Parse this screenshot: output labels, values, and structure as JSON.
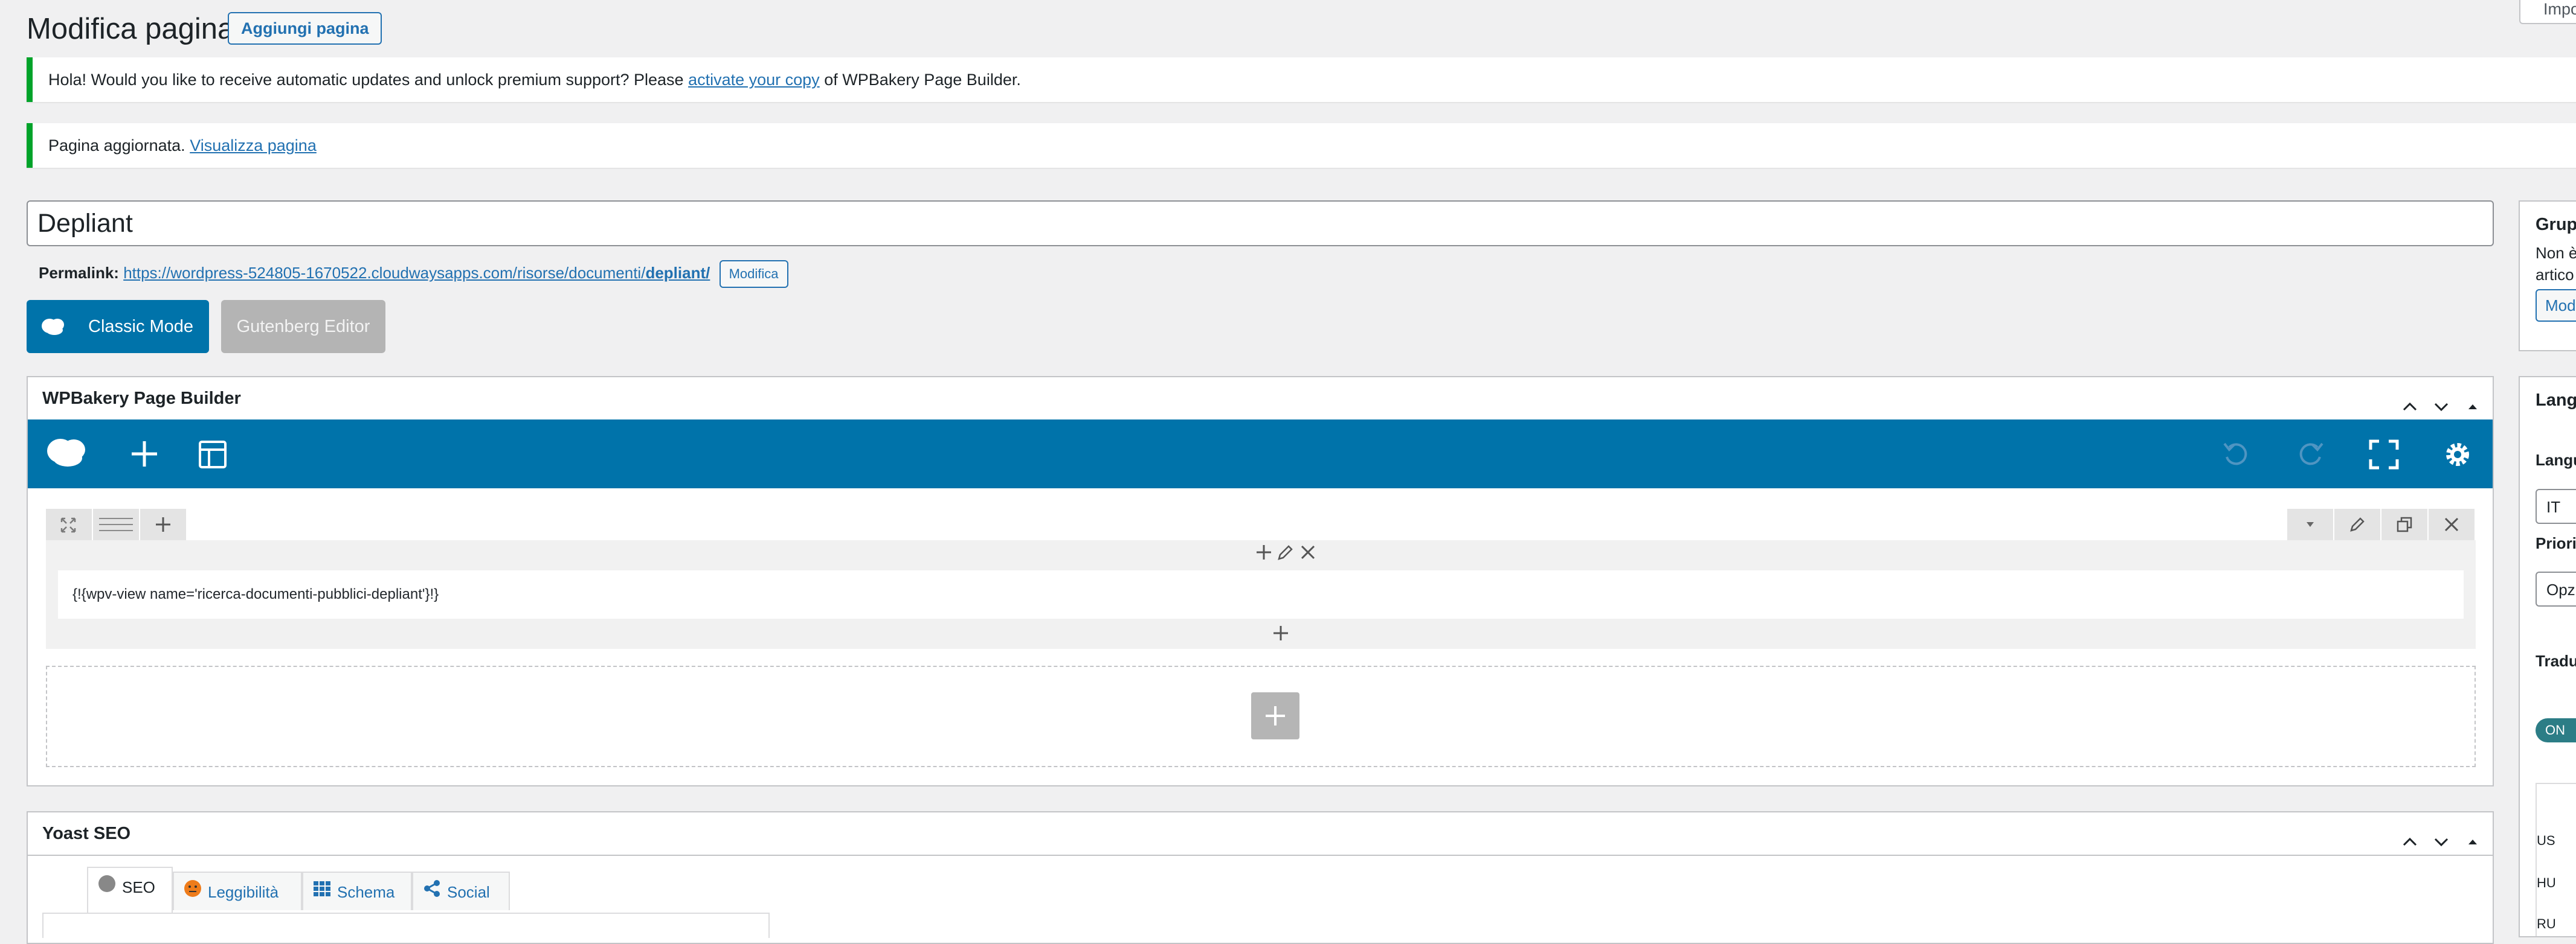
{
  "header": {
    "title": "Modifica pagina",
    "add_page_label": "Aggiungi pagina",
    "screen_options_label": "Impo"
  },
  "notices": {
    "update": {
      "text_before": "Hola! Would you like to receive automatic updates and unlock premium support? Please ",
      "link_text": "activate your copy",
      "text_after": " of WPBakery Page Builder."
    },
    "saved": {
      "text": "Pagina aggiornata. ",
      "link_text": "Visualizza pagina"
    }
  },
  "post": {
    "title": "Depliant",
    "permalink_label": "Permalink:",
    "permalink_base": "https://wordpress-524805-1670522.cloudwaysapps.com/risorse/documenti/",
    "permalink_slug": "depliant/",
    "permalink_edit_label": "Modifica"
  },
  "modes": {
    "classic_label": "Classic Mode",
    "gutenberg_label": "Gutenberg Editor"
  },
  "wpbakery": {
    "box_title": "WPBakery Page Builder",
    "shortcode": "{!{wpv-view name='ricerca-documenti-pubblici-depliant'}!}"
  },
  "yoast": {
    "box_title": "Yoast SEO",
    "tabs": [
      {
        "label": "SEO",
        "icon": "circle-icon"
      },
      {
        "label": "Leggibilità",
        "icon": "smiley-icon"
      },
      {
        "label": "Schema",
        "icon": "grid-icon"
      },
      {
        "label": "Social",
        "icon": "share-icon"
      }
    ]
  },
  "sidebar": {
    "group_title": "Grup",
    "group_text_1": "Non è",
    "group_text_2": "artico",
    "group_button": "Mod",
    "lang_title": "Lang",
    "lang_label": "Langu",
    "lang_value": "IT",
    "priority_label": "Priori",
    "priority_value": "Opz",
    "translate_label": "Tradu",
    "toggle_label": "ON",
    "lang_rows": [
      "US",
      "HU",
      "RU"
    ]
  },
  "colors": {
    "accent": "#2271b1",
    "wpbakery_bar": "#0073aa",
    "notice_border": "#00a32a",
    "disabled_button": "#b4b4b4"
  }
}
